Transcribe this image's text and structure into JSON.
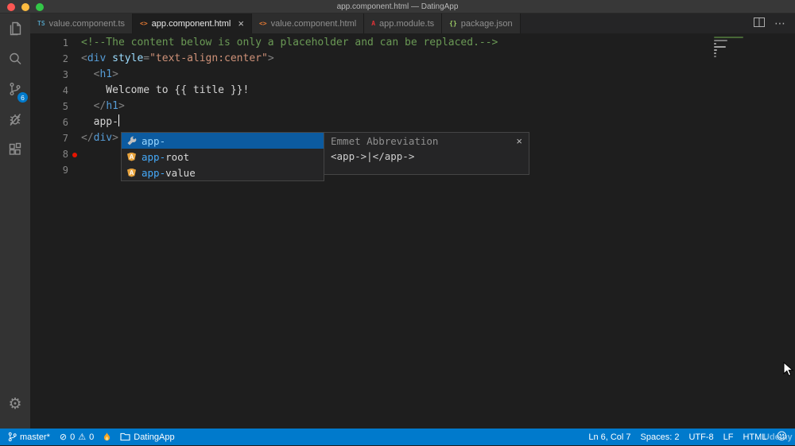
{
  "window": {
    "title": "app.component.html — DatingApp"
  },
  "activity_bar": {
    "items": [
      "explorer-icon",
      "search-icon",
      "source-control-icon",
      "debug-icon",
      "extensions-icon"
    ],
    "badge": "6",
    "bottom": [
      "settings-gear-icon"
    ]
  },
  "tabs": [
    {
      "label": "value.component.ts",
      "icon": "ts",
      "active": false
    },
    {
      "label": "app.component.html",
      "icon": "html",
      "active": true,
      "close": "×"
    },
    {
      "label": "value.component.html",
      "icon": "html",
      "active": false
    },
    {
      "label": "app.module.ts",
      "icon": "ng",
      "active": false
    },
    {
      "label": "package.json",
      "icon": "json",
      "active": false
    }
  ],
  "tab_actions": {
    "more": "⋯"
  },
  "editor": {
    "lines": [
      {
        "n": "1",
        "tokens": [
          [
            "comment",
            "<!--The content below is only a placeholder and can be replaced.-->"
          ]
        ]
      },
      {
        "n": "2",
        "tokens": [
          [
            "punct",
            "<"
          ],
          [
            "tag",
            "div"
          ],
          [
            "plain",
            " "
          ],
          [
            "attr",
            "style"
          ],
          [
            "punct",
            "="
          ],
          [
            "str",
            "\"text-align:center\""
          ],
          [
            "punct",
            ">"
          ]
        ]
      },
      {
        "n": "3",
        "tokens": [
          [
            "plain",
            "  "
          ],
          [
            "punct",
            "<"
          ],
          [
            "tag",
            "h1"
          ],
          [
            "punct",
            ">"
          ]
        ]
      },
      {
        "n": "4",
        "tokens": [
          [
            "plain",
            "    Welcome to {{ title }}!"
          ]
        ]
      },
      {
        "n": "5",
        "tokens": [
          [
            "plain",
            "  "
          ],
          [
            "punct",
            "</"
          ],
          [
            "tag",
            "h1"
          ],
          [
            "punct",
            ">"
          ]
        ]
      },
      {
        "n": "6",
        "tokens": [
          [
            "plain",
            "  app-"
          ]
        ],
        "cursor": true
      },
      {
        "n": "7",
        "tokens": [
          [
            "punct",
            "</"
          ],
          [
            "tag",
            "div"
          ],
          [
            "punct",
            ">"
          ]
        ]
      },
      {
        "n": "8",
        "tokens": [],
        "marker": "error"
      },
      {
        "n": "9",
        "tokens": []
      }
    ]
  },
  "suggest": {
    "items": [
      {
        "icon": "wrench",
        "match": "app-",
        "rest": "",
        "selected": true
      },
      {
        "icon": "angular",
        "match": "app-",
        "rest": "root",
        "selected": false
      },
      {
        "icon": "angular",
        "match": "app-",
        "rest": "value",
        "selected": false
      }
    ],
    "doc": {
      "title": "Emmet Abbreviation",
      "body": "<app->|</app->",
      "close": "×"
    }
  },
  "status_bar": {
    "branch": "master*",
    "errors": "0",
    "warnings": "0",
    "project": "DatingApp",
    "position": "Ln 6, Col 7",
    "indent": "Spaces: 2",
    "encoding": "UTF-8",
    "eol": "LF",
    "language": "HTML",
    "icons": [
      "git-branch-icon",
      "error-icon",
      "warning-icon",
      "flame-icon",
      "folder-icon",
      "smiley-icon"
    ]
  },
  "watermark": {
    "text": "Udemy"
  },
  "colors": {
    "accent": "#007acc",
    "status_bar": "#007acc",
    "suggest_selection": "#0c5ba0",
    "error": "#e51400",
    "comment": "#6a9955",
    "tag": "#569cd6",
    "attribute": "#9cdcfe",
    "string": "#ce9178"
  }
}
